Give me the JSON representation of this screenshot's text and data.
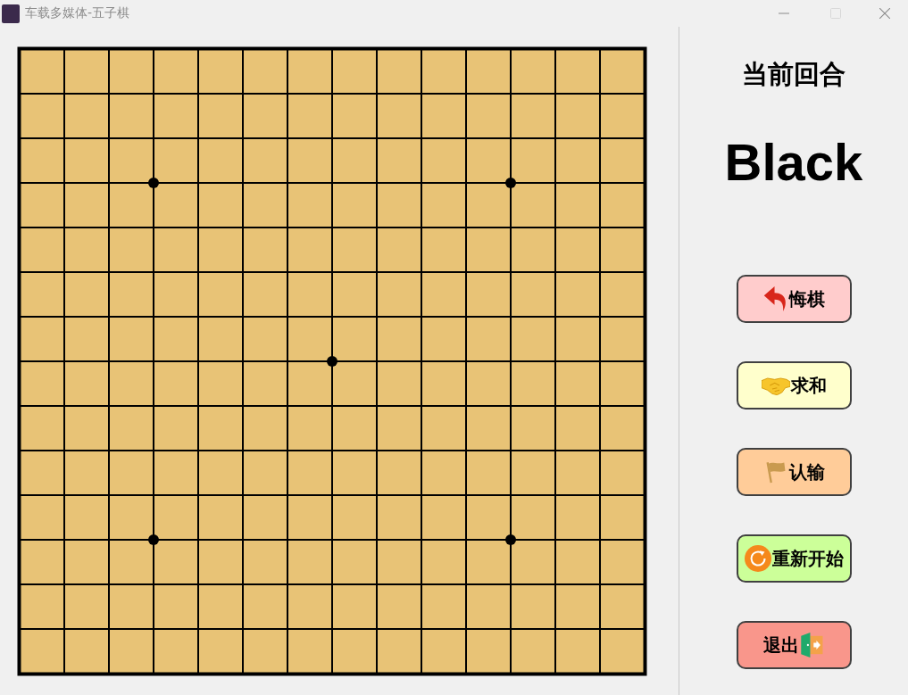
{
  "window": {
    "title": "车载多媒体-五子棋",
    "controls": [
      {
        "kind": "minimize",
        "disabled": false
      },
      {
        "kind": "maximize",
        "disabled": true
      },
      {
        "kind": "close",
        "disabled": false
      }
    ]
  },
  "turn_panel": {
    "heading": "当前回合",
    "player": "Black"
  },
  "buttons": [
    {
      "label": "悔棋",
      "kind": "undo",
      "color": "#ffcccc",
      "icon_after": false
    },
    {
      "label": "求和",
      "kind": "handshake",
      "color": "#ffffcc",
      "icon_after": false
    },
    {
      "label": "认输",
      "kind": "flag",
      "color": "#ffcc99",
      "icon_after": false
    },
    {
      "label": "重新开始",
      "kind": "restart",
      "color": "#ccff99",
      "icon_after": false
    },
    {
      "label": "退出",
      "kind": "exit",
      "color": "#f9968b",
      "icon_after": true
    }
  ]
}
